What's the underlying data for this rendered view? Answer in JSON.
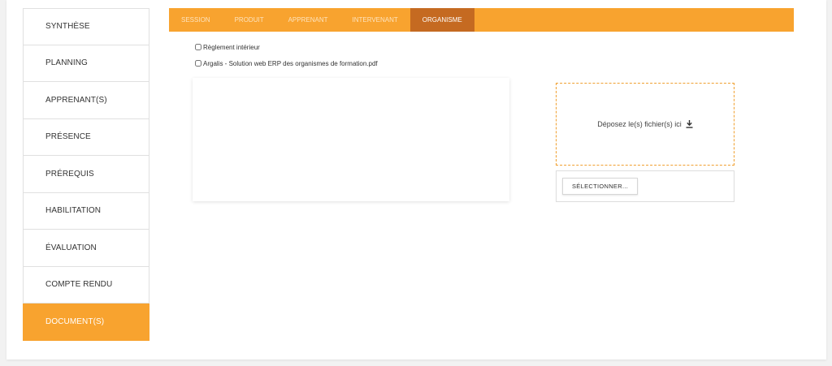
{
  "sidebar": {
    "items": [
      {
        "label": "SYNTHÈSE"
      },
      {
        "label": "PLANNING"
      },
      {
        "label": "APPRENANT(S)"
      },
      {
        "label": "PRÉSENCE"
      },
      {
        "label": "PRÉREQUIS"
      },
      {
        "label": "HABILITATION"
      },
      {
        "label": "ÉVALUATION"
      },
      {
        "label": "COMPTE RENDU"
      },
      {
        "label": "DOCUMENT(S)"
      }
    ],
    "active_index": 8
  },
  "tabs": [
    {
      "label": "SESSION"
    },
    {
      "label": "PRODUIT"
    },
    {
      "label": "APPRENANT"
    },
    {
      "label": "INTERVENANT"
    },
    {
      "label": "ORGANISME"
    }
  ],
  "active_tab_index": 4,
  "files": [
    {
      "label": "Règlement intérieur"
    },
    {
      "label": "Argalis - Solution web ERP des organismes de formation.pdf"
    }
  ],
  "dropzone": {
    "text": "Déposez le(s) fichier(s) ici",
    "icon": "download-icon"
  },
  "select_button": {
    "label": "SÉLECTIONNER..."
  },
  "colors": {
    "accent": "#f8a32f",
    "accent_dark": "#c56a21"
  }
}
